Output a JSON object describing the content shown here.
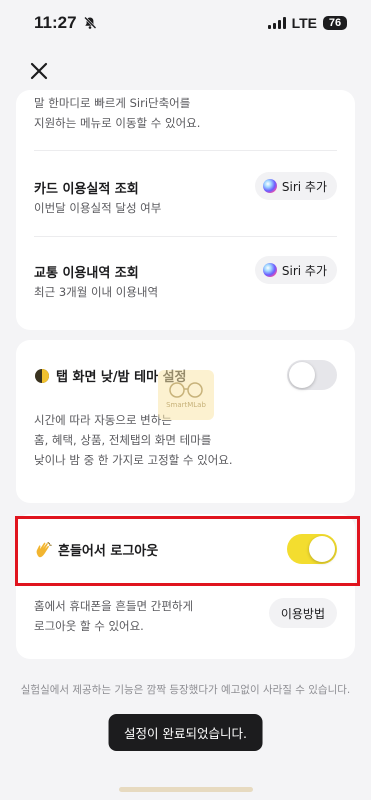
{
  "status_bar": {
    "time": "11:27",
    "network": "LTE",
    "battery": "76"
  },
  "shortcuts_card": {
    "intro_line1": "말 한마디로 빠르게 Siri단축어를",
    "intro_line2": "지원하는 메뉴로 이동할 수 있어요.",
    "items": [
      {
        "title": "카드 이용실적 조회",
        "subtitle": "이번달 이용실적 달성 여부",
        "button": "Siri 추가"
      },
      {
        "title": "교통 이용내역 조회",
        "subtitle": "최근 3개월 이내 이용내역",
        "button": "Siri 추가"
      }
    ]
  },
  "theme_card": {
    "title": "탭 화면 낮/밤 테마 설정",
    "toggle_on": false,
    "desc_line1": "시간에 따라 자동으로 변하는",
    "desc_line2": "홈, 혜택, 상품, 전체탭의 화면 테마를",
    "desc_line3": "낮이나 밤 중 한 가지로 고정할 수 있어요."
  },
  "shake_card": {
    "title": "흔들어서 로그아웃",
    "toggle_on": true,
    "desc_line1": "홈에서 휴대폰을 흔들면 간편하게",
    "desc_line2": "로그아웃 할 수 있어요.",
    "how_button": "이용방법"
  },
  "watermark_text": "SmartMLab",
  "footer_note": "실험실에서 제공하는 기능은 깜짝 등장했다가 예고없이 사라질 수 있습니다.",
  "toast": "설정이 완료되었습니다.",
  "colors": {
    "toggle_on": "#f3dd2f",
    "toggle_off": "#e6e6ea",
    "highlight": "#e0141e"
  }
}
